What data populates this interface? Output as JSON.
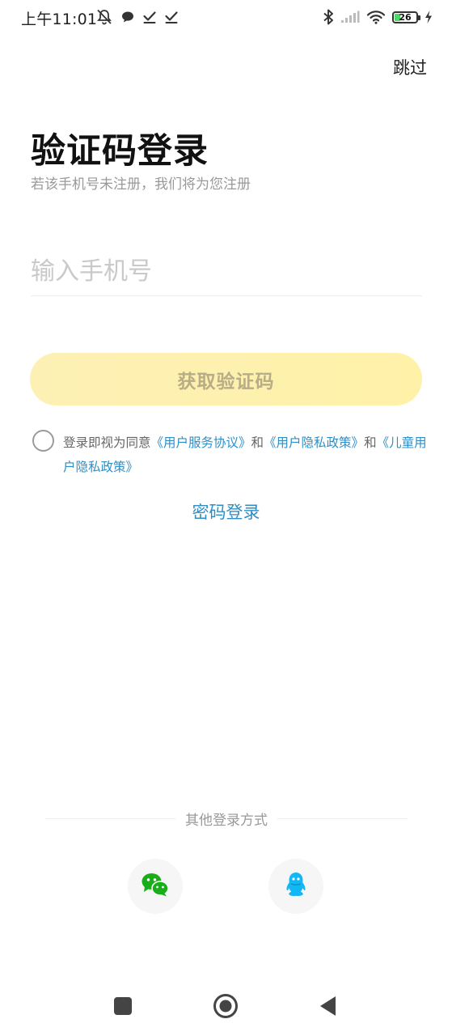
{
  "status_bar": {
    "time": "上午11:01",
    "battery_level": "26",
    "battery_fraction": 0.26,
    "left_icons": [
      "mute-alarm-icon",
      "chat-bubble-icon",
      "check-icon",
      "check-icon"
    ],
    "right_icons": [
      "bluetooth-icon",
      "signal-icon",
      "wifi-icon",
      "battery-icon",
      "charging-icon"
    ]
  },
  "header": {
    "skip_label": "跳过"
  },
  "main": {
    "title": "验证码登录",
    "subtitle": "若该手机号未注册，我们将为您注册",
    "phone_input": {
      "value": "",
      "placeholder": "输入手机号"
    },
    "get_code_label": "获取验证码",
    "agreement": {
      "checked": false,
      "prefix": "登录即视为同意",
      "link_service": "《用户服务协议》",
      "and_1": "和",
      "link_privacy": "《用户隐私政策》",
      "and_2": "和",
      "link_child_privacy": "《儿童用户隐私政策》"
    },
    "password_login_label": "密码登录"
  },
  "other_login": {
    "label": "其他登录方式",
    "options": [
      {
        "name": "wechat",
        "icon": "wechat-icon",
        "color": "#1aad19"
      },
      {
        "name": "qq",
        "icon": "qq-icon",
        "color": "#12b7f5"
      }
    ]
  },
  "colors": {
    "accent_link": "#2f8fc4",
    "button_bg": "#fff1a8",
    "button_text": "#b7ad86",
    "placeholder": "#c9c9c9"
  },
  "nav_bar": {
    "buttons": [
      "recents-icon",
      "home-icon",
      "back-icon"
    ]
  }
}
